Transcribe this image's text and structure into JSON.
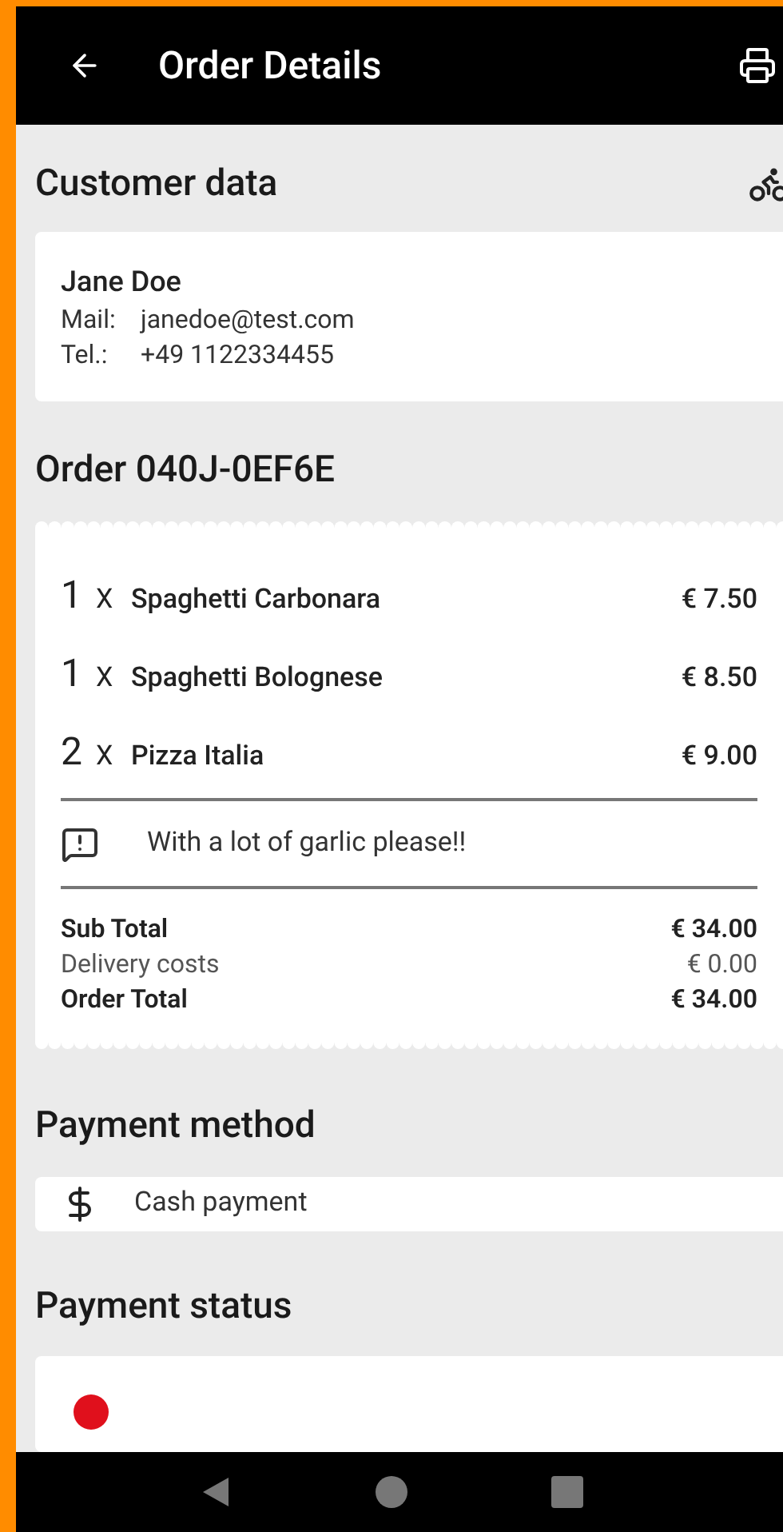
{
  "app_bar": {
    "title": "Order Details"
  },
  "customer": {
    "heading": "Customer data",
    "name": "Jane Doe",
    "fields": [
      {
        "label": "Mail:",
        "value": "janedoe@test.com"
      },
      {
        "label": "Tel.:",
        "value": "+49 1122334455"
      }
    ]
  },
  "order": {
    "heading": "Order 040J-0EF6E",
    "items": [
      {
        "qty": "1",
        "x": "X",
        "name": "Spaghetti Carbonara",
        "price": "€ 7.50"
      },
      {
        "qty": "1",
        "x": "X",
        "name": "Spaghetti Bolognese",
        "price": "€ 8.50"
      },
      {
        "qty": "2",
        "x": "X",
        "name": "Pizza Italia",
        "price": "€ 9.00"
      }
    ],
    "note": "With a lot of garlic please!!",
    "totals": [
      {
        "label": "Sub Total",
        "value": "€ 34.00",
        "kind": "bold"
      },
      {
        "label": "Delivery costs",
        "value": "€ 0.00",
        "kind": "normal"
      },
      {
        "label": "Order Total",
        "value": "€ 34.00",
        "kind": "bold"
      }
    ]
  },
  "payment_method": {
    "heading": "Payment method",
    "method": "Cash payment"
  },
  "payment_status": {
    "heading": "Payment status",
    "color": "#e0101c"
  }
}
